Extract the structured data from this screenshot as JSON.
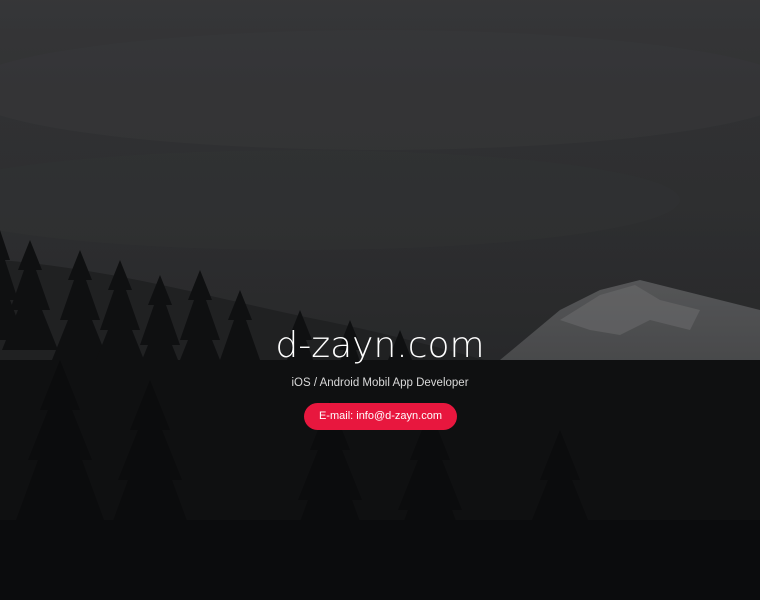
{
  "site": {
    "title": "d-zayn.com",
    "subtitle": "iOS / Android Mobil App Developer",
    "cta_label": "E-mail: info@d-zayn.com"
  },
  "colors": {
    "cta_background": "#e8173e",
    "title_text": "#ffffff",
    "subtitle_text": "#d9d9d9",
    "background": "#2b2c2e"
  },
  "background_image": {
    "icon": "misty-mountain-forest-photo"
  }
}
